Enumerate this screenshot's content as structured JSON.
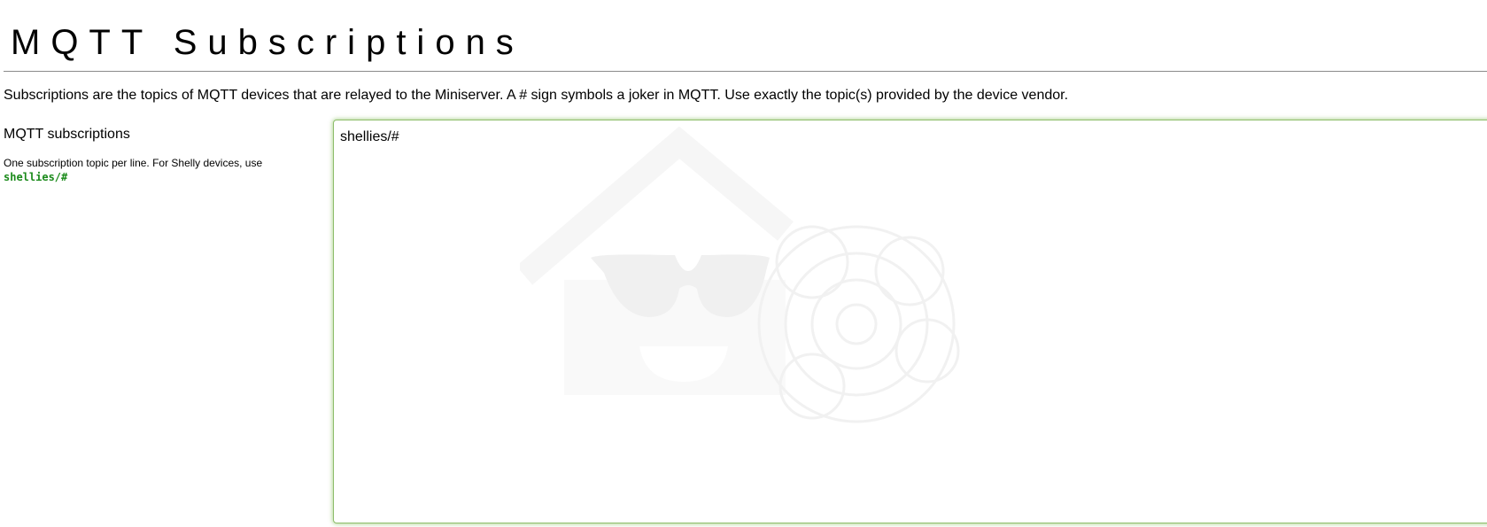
{
  "page": {
    "title": "MQTT Subscriptions",
    "intro": "Subscriptions are the topics of MQTT devices that are relayed to the Miniserver. A # sign symbols a joker in MQTT. Use exactly the topic(s) provided by the device vendor."
  },
  "subscriptions_field": {
    "label": "MQTT subscriptions",
    "help_text": "One subscription topic per line. For Shelly devices, use",
    "help_code": "shellies/#",
    "value": "shellies/#"
  },
  "colors": {
    "accent_green": "#1a8a1a",
    "focus_border": "#8dbd6a"
  },
  "icons": {
    "watermark": "house-with-sunglasses-logo"
  }
}
